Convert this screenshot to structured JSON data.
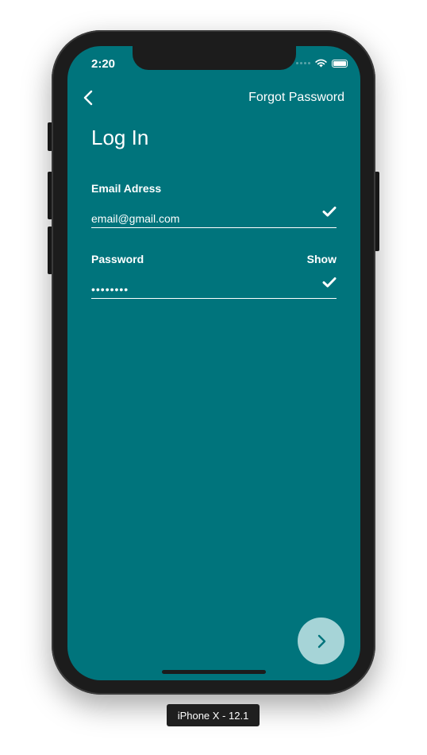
{
  "status_bar": {
    "time": "2:20"
  },
  "header": {
    "back_icon": "chevron-left-icon",
    "forgot_password_label": "Forgot Password"
  },
  "page": {
    "title": "Log In"
  },
  "form": {
    "email": {
      "label": "Email Adress",
      "value": "email@gmail.com",
      "valid_icon": "checkmark-icon"
    },
    "password": {
      "label": "Password",
      "show_label": "Show",
      "value": "••••••••",
      "valid_icon": "checkmark-icon"
    }
  },
  "next_button": {
    "icon": "chevron-right-icon"
  },
  "device_label": "iPhone X - 12.1",
  "colors": {
    "background": "#00747c",
    "fab": "#a6d4d7",
    "text": "#ffffff",
    "device": "#1c1c1c"
  }
}
